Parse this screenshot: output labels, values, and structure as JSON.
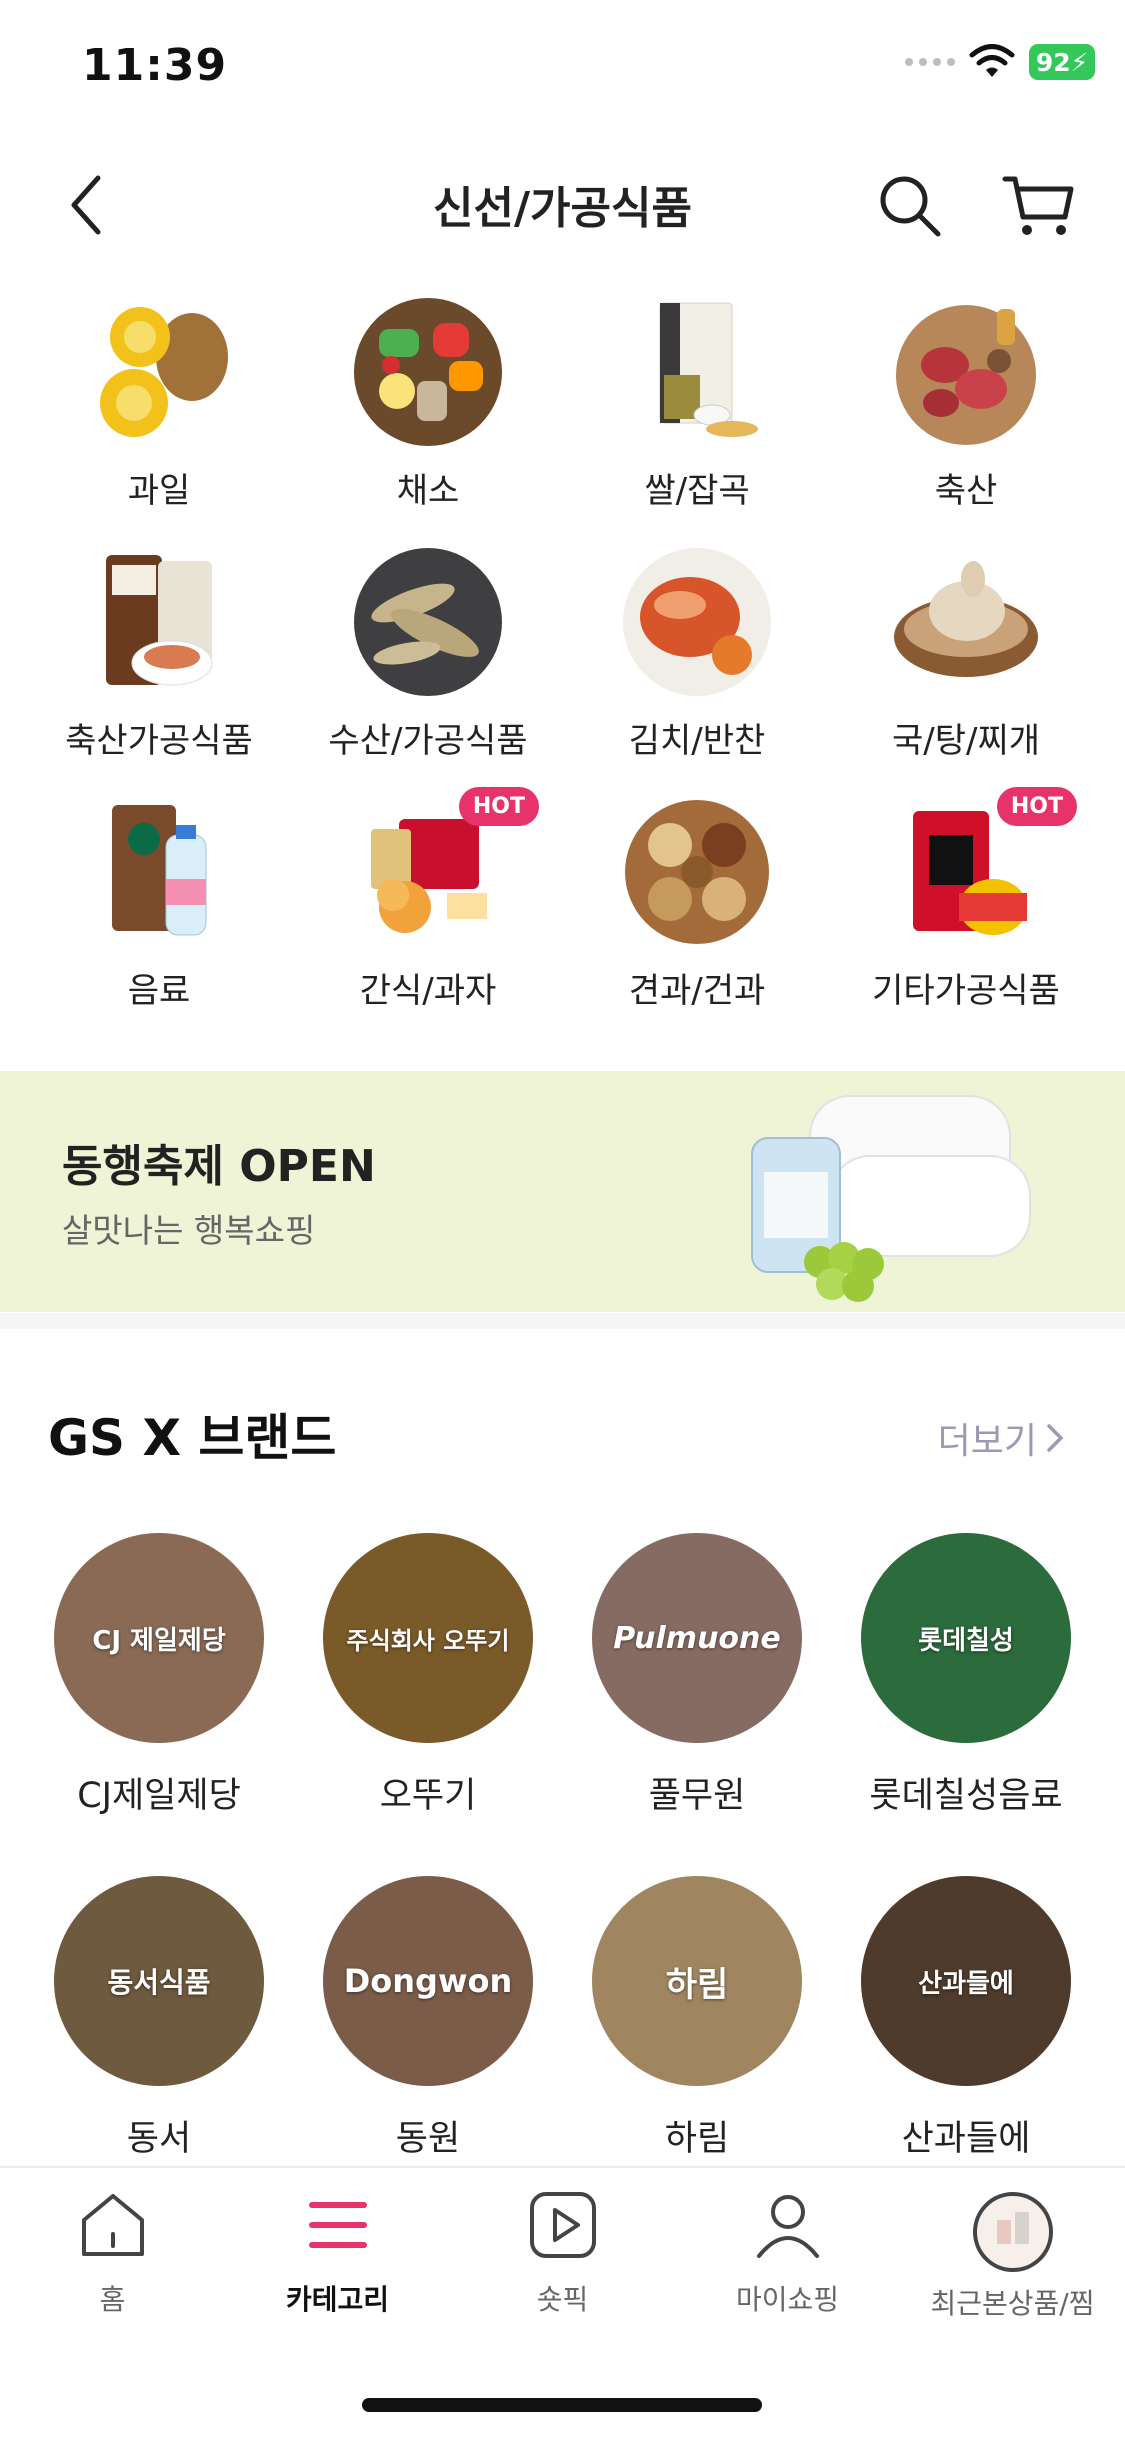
{
  "status": {
    "time": "11:39",
    "battery": "92"
  },
  "header": {
    "title": "신선/가공식품"
  },
  "categories": [
    {
      "label": "과일"
    },
    {
      "label": "채소"
    },
    {
      "label": "쌀/잡곡"
    },
    {
      "label": "축산"
    },
    {
      "label": "축산가공식품"
    },
    {
      "label": "수산/가공식품"
    },
    {
      "label": "김치/반찬"
    },
    {
      "label": "국/탕/찌개"
    },
    {
      "label": "음료"
    },
    {
      "label": "간식/과자",
      "badge": "HOT"
    },
    {
      "label": "견과/건과"
    },
    {
      "label": "기타가공식품",
      "badge": "HOT"
    }
  ],
  "banner": {
    "title": "동행축제 OPEN",
    "subtitle": "살맛나는 행복쇼핑"
  },
  "brands": {
    "title": "GS X 브랜드",
    "more_label": "더보기",
    "items": [
      {
        "label": "CJ제일제당",
        "logo": "CJ 제일제당"
      },
      {
        "label": "오뚜기",
        "logo": "주식회사 오뚜기"
      },
      {
        "label": "풀무원",
        "logo": "Pulmuone"
      },
      {
        "label": "롯데칠성음료",
        "logo": "롯데칠성"
      },
      {
        "label": "동서",
        "logo": "동서식품"
      },
      {
        "label": "동원",
        "logo": "Dongwon"
      },
      {
        "label": "하림",
        "logo": "하림"
      },
      {
        "label": "산과들에",
        "logo": "산과들에"
      }
    ]
  },
  "nav": [
    {
      "label": "홈",
      "icon": "home-icon"
    },
    {
      "label": "카테고리",
      "icon": "menu-icon",
      "active": true
    },
    {
      "label": "숏픽",
      "icon": "play-icon"
    },
    {
      "label": "마이쇼핑",
      "icon": "person-icon"
    },
    {
      "label": "최근본상품/찜",
      "icon": "recent-thumbnail"
    }
  ],
  "colors": {
    "accent": "#e8336a",
    "banner_bg": "#eef4d5",
    "more_text": "#9a9ab5"
  }
}
